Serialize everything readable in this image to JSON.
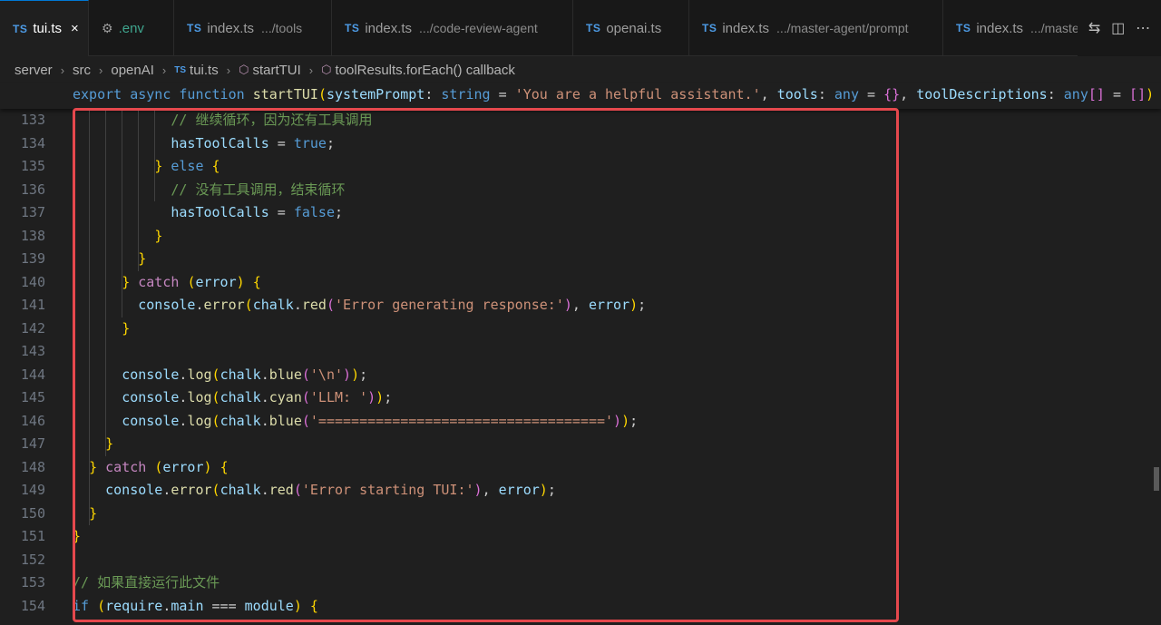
{
  "tabs": [
    {
      "ext": "TS",
      "name": "tui.ts",
      "desc": "",
      "active": true,
      "close": "×"
    },
    {
      "ext": "",
      "name": ".env",
      "desc": "",
      "active": false
    },
    {
      "ext": "TS",
      "name": "index.ts",
      "desc": ".../tools",
      "active": false
    },
    {
      "ext": "TS",
      "name": "index.ts",
      "desc": ".../code-review-agent",
      "active": false
    },
    {
      "ext": "TS",
      "name": "openai.ts",
      "desc": "",
      "active": false
    },
    {
      "ext": "TS",
      "name": "index.ts",
      "desc": ".../master-agent/prompt",
      "active": false
    },
    {
      "ext": "TS",
      "name": "index.ts",
      "desc": ".../master",
      "active": false
    }
  ],
  "breadcrumb": {
    "items": [
      "server",
      "src",
      "openAI",
      "tui.ts",
      "startTUI",
      "toolResults.forEach() callback"
    ],
    "file_ext": "TS"
  },
  "sticky_line": "export async function startTUI(systemPrompt: string = 'You are a helpful assistant.', tools: any = {}, toolDescriptions: any[] = [])",
  "code_lines": [
    {
      "n": "133",
      "text": "            // 继续循环，因为还有工具调用"
    },
    {
      "n": "134",
      "text": "            hasToolCalls = true;"
    },
    {
      "n": "135",
      "text": "          } else {"
    },
    {
      "n": "136",
      "text": "            // 没有工具调用，结束循环"
    },
    {
      "n": "137",
      "text": "            hasToolCalls = false;"
    },
    {
      "n": "138",
      "text": "          }"
    },
    {
      "n": "139",
      "text": "        }"
    },
    {
      "n": "140",
      "text": "      } catch (error) {"
    },
    {
      "n": "141",
      "text": "        console.error(chalk.red('Error generating response:'), error);"
    },
    {
      "n": "142",
      "text": "      }"
    },
    {
      "n": "143",
      "text": ""
    },
    {
      "n": "144",
      "text": "      console.log(chalk.blue('\\n'));"
    },
    {
      "n": "145",
      "text": "      console.log(chalk.cyan('LLM: '));"
    },
    {
      "n": "146",
      "text": "      console.log(chalk.blue('==================================='));"
    },
    {
      "n": "147",
      "text": "    }"
    },
    {
      "n": "148",
      "text": "  } catch (error) {"
    },
    {
      "n": "149",
      "text": "    console.error(chalk.red('Error starting TUI:'), error);"
    },
    {
      "n": "150",
      "text": "  }"
    },
    {
      "n": "151",
      "text": "}"
    },
    {
      "n": "152",
      "text": ""
    },
    {
      "n": "153",
      "text": "// 如果直接运行此文件"
    },
    {
      "n": "154",
      "text": "if (require.main === module) {"
    }
  ],
  "colors": {
    "highlight": "#e5484d",
    "accent": "#0078d4",
    "ts_badge": "#4d9be6"
  },
  "icons": {
    "env_tab": "gear-icon",
    "close": "close-icon",
    "compare": "git-compare-icon",
    "split": "split-editor-icon",
    "more": "more-icon"
  }
}
